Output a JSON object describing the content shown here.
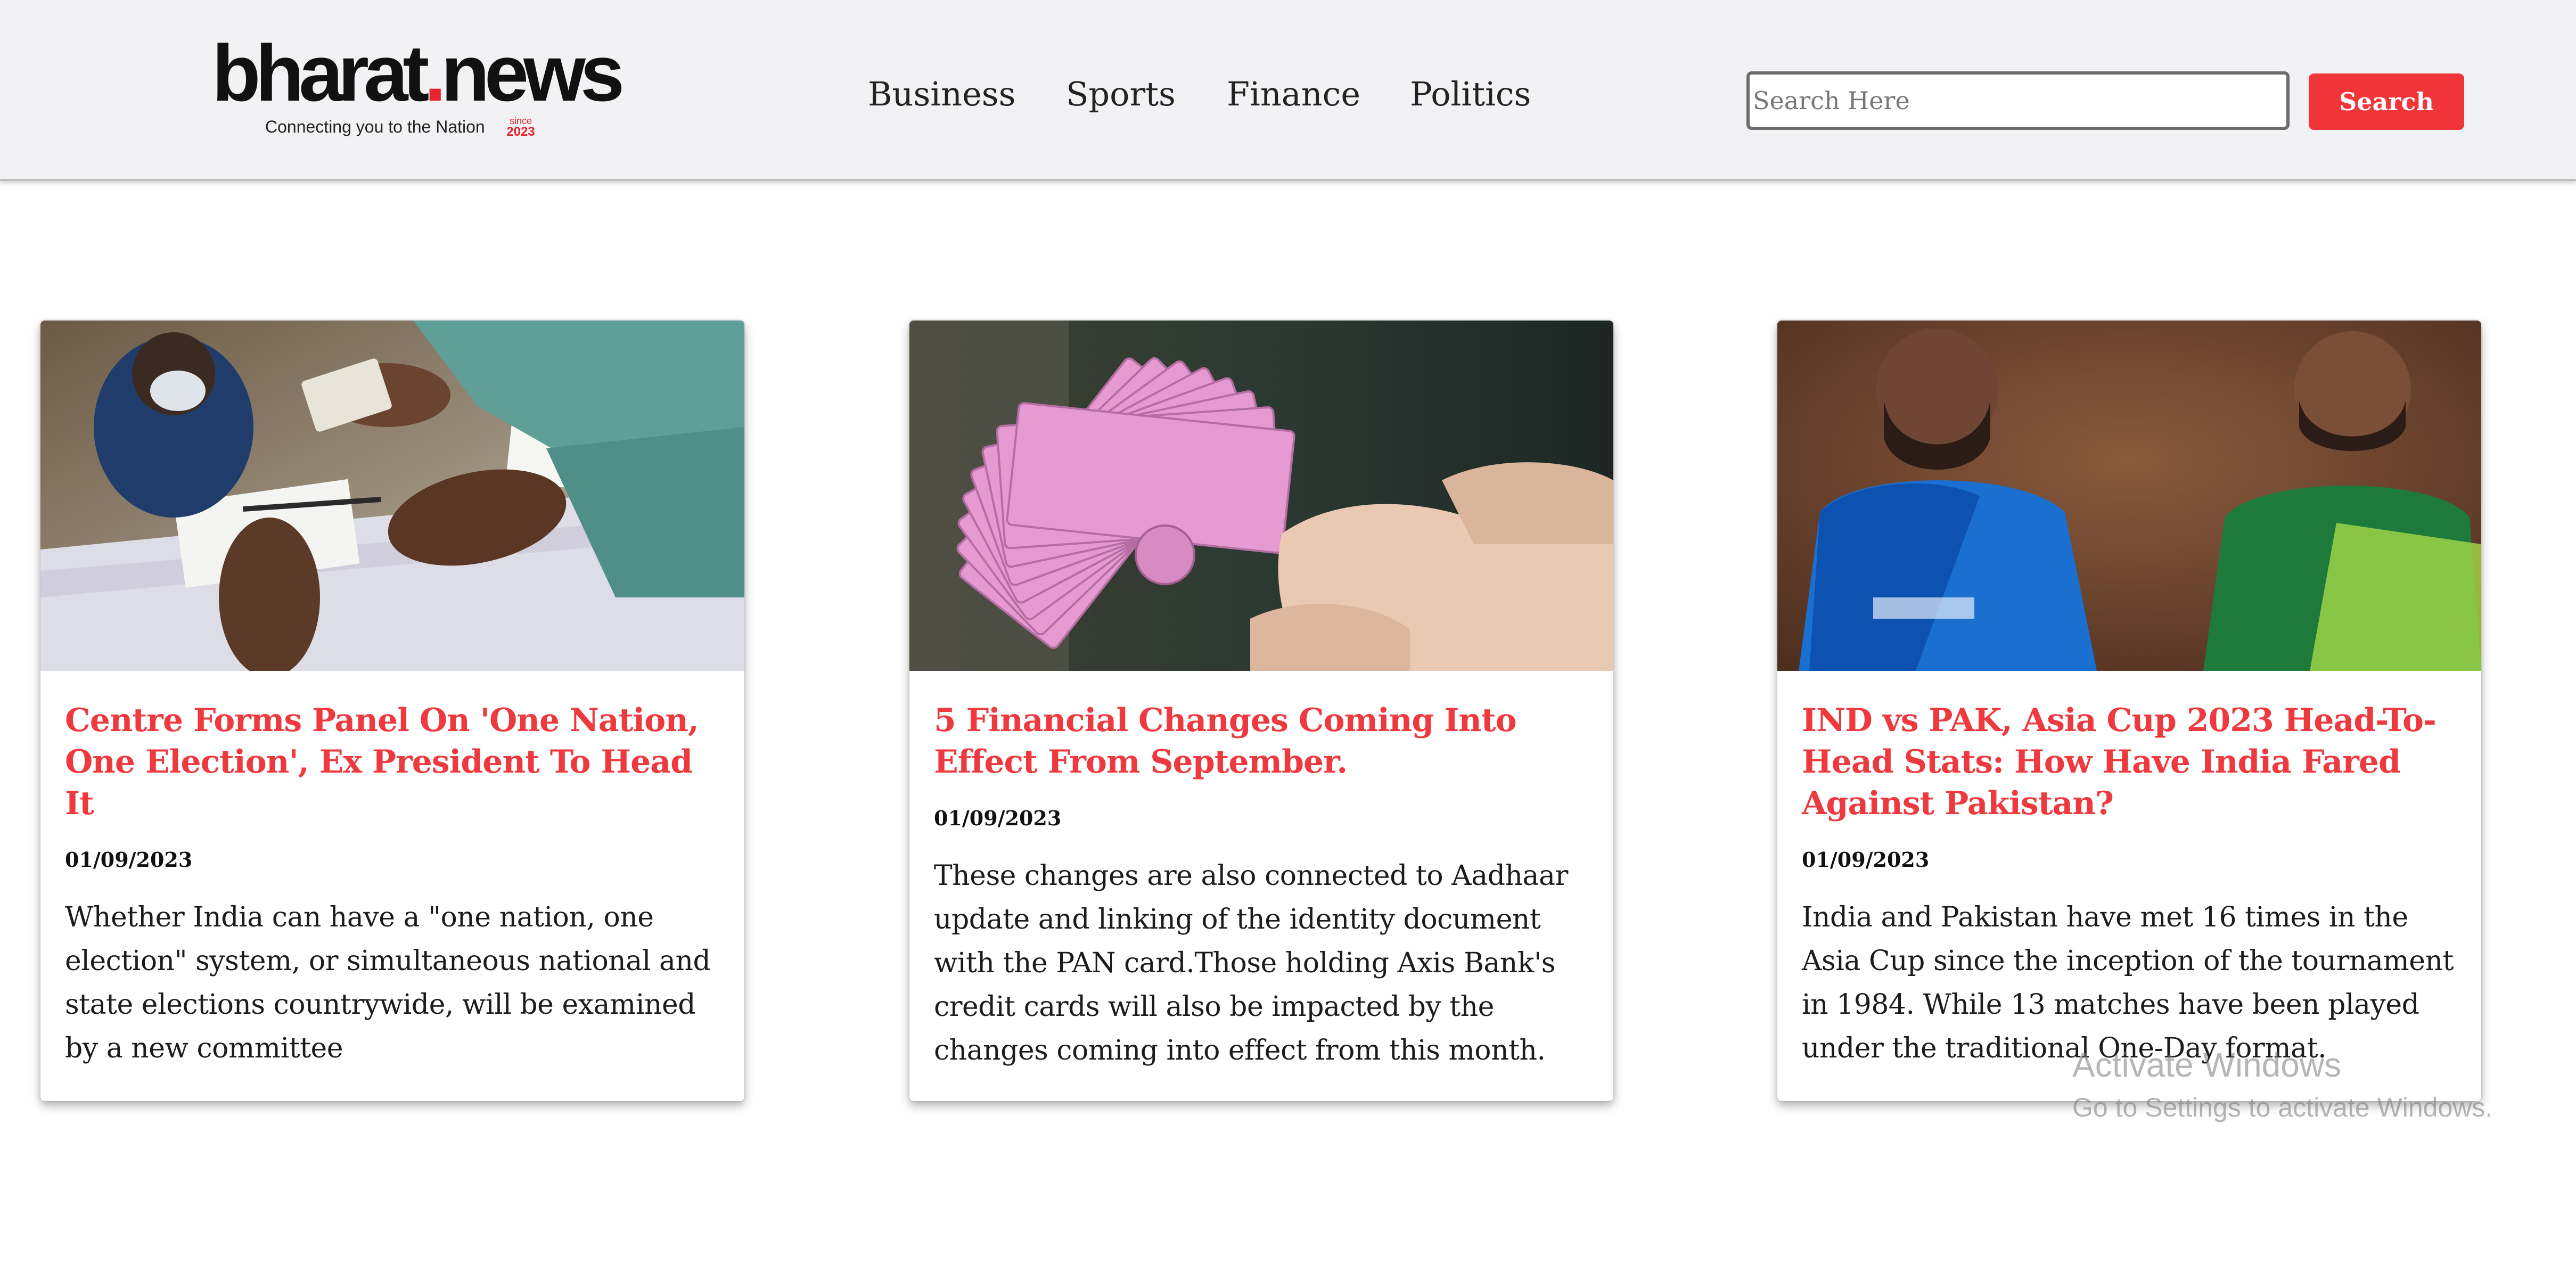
{
  "header": {
    "logo": {
      "brand_main": "bharat",
      "brand_dot": ".",
      "brand_suffix": "news",
      "tagline": "Connecting you to the Nation",
      "since_label": "since",
      "since_year": "2023"
    },
    "nav": [
      {
        "label": "Business"
      },
      {
        "label": "Sports"
      },
      {
        "label": "Finance"
      },
      {
        "label": "Politics"
      }
    ],
    "search": {
      "placeholder": "Search Here",
      "value": "",
      "button_label": "Search"
    }
  },
  "articles": [
    {
      "title": "Centre Forms Panel On 'One Nation, One Election', Ex President To Head It",
      "date": "01/09/2023",
      "summary": "Whether India can have a \"one nation, one election\" system, or simultaneous national and state elections countrywide, will be examined by a new committee"
    },
    {
      "title": "5 Financial Changes Coming Into Effect From September.",
      "date": "01/09/2023",
      "summary": "These changes are also connected to Aadhaar update and linking of the identity document with the PAN card.Those holding Axis Bank's credit cards will also be impacted by the changes coming into effect from this month."
    },
    {
      "title": "IND vs PAK, Asia Cup 2023 Head-To-Head Stats: How Have India Fared Against Pakistan?",
      "date": "01/09/2023",
      "summary": "India and Pakistan have met 16 times in the Asia Cup since the inception of the tournament in 1984. While 13 matches have been played under the traditional One-Day format."
    }
  ],
  "watermark": {
    "line1": "Activate Windows",
    "line2": "Go to Settings to activate Windows."
  },
  "colors": {
    "accent": "#ee3a3e",
    "search_button": "#f23539",
    "header_bg": "#f2f2f4"
  },
  "icons": {
    "card1_image": "voting-ink-finger-image",
    "card2_image": "rupee-notes-hand-image",
    "card3_image": "cricket-captains-image"
  }
}
